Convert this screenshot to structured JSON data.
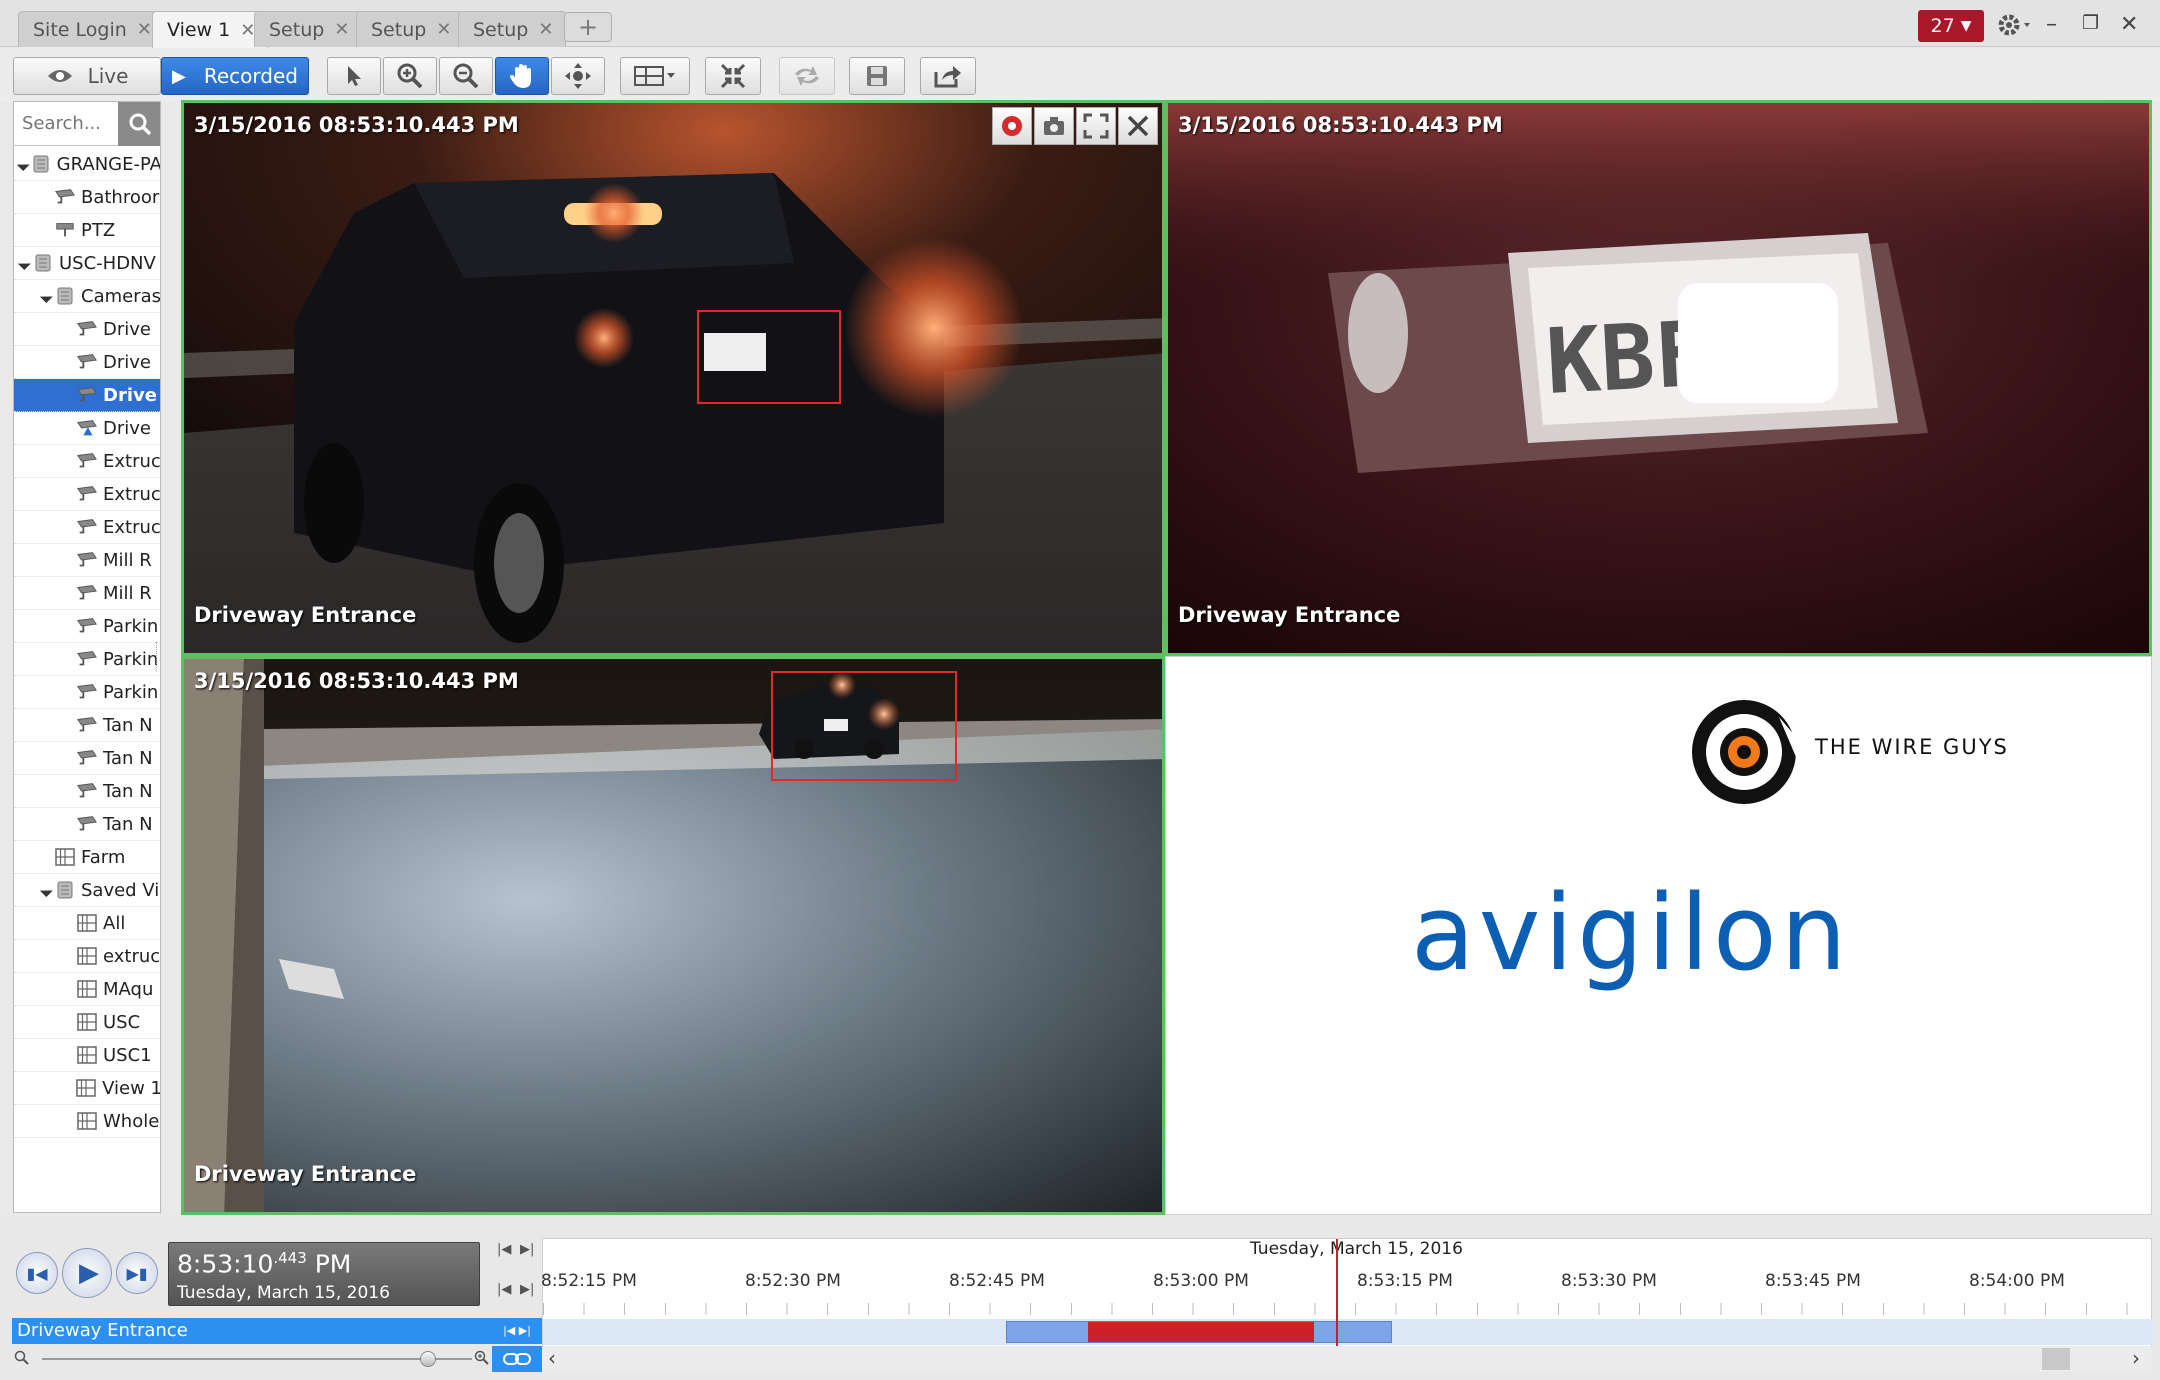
{
  "tabs": [
    {
      "label": "Site Login",
      "active": false
    },
    {
      "label": "View 1",
      "active": true
    },
    {
      "label": "Setup",
      "active": false
    },
    {
      "label": "Setup",
      "active": false
    },
    {
      "label": "Setup",
      "active": false
    }
  ],
  "tab_add": "+",
  "alarm_count": "27",
  "toolbar": {
    "live_label": "Live",
    "recorded_label": "Recorded"
  },
  "search": {
    "placeholder": "Search..."
  },
  "tree": [
    {
      "label": "GRANGE-PA",
      "level": 0,
      "icon": "server-icon",
      "expanded": true
    },
    {
      "label": "Bathroor",
      "level": 1,
      "icon": "camera-icon"
    },
    {
      "label": "PTZ",
      "level": 1,
      "icon": "ptz-camera-icon"
    },
    {
      "label": "USC-HDNV",
      "level": 0,
      "icon": "server-icon",
      "expanded": true
    },
    {
      "label": "Cameras",
      "level": 1,
      "icon": "folder-icon",
      "expanded": true
    },
    {
      "label": "Drive",
      "level": 2,
      "icon": "camera-icon"
    },
    {
      "label": "Drive",
      "level": 2,
      "icon": "camera-icon"
    },
    {
      "label": "Drive",
      "level": 2,
      "icon": "camera-icon",
      "selected": true
    },
    {
      "label": "Drive",
      "level": 2,
      "icon": "camera-warning-icon"
    },
    {
      "label": "Extruc",
      "level": 2,
      "icon": "camera-icon"
    },
    {
      "label": "Extruc",
      "level": 2,
      "icon": "camera-icon"
    },
    {
      "label": "Extruc",
      "level": 2,
      "icon": "camera-icon"
    },
    {
      "label": "Mill R",
      "level": 2,
      "icon": "camera-icon"
    },
    {
      "label": "Mill R",
      "level": 2,
      "icon": "camera-icon"
    },
    {
      "label": "Parkin",
      "level": 2,
      "icon": "camera-icon"
    },
    {
      "label": "Parkin",
      "level": 2,
      "icon": "camera-icon"
    },
    {
      "label": "Parkin",
      "level": 2,
      "icon": "camera-icon"
    },
    {
      "label": "Tan N",
      "level": 2,
      "icon": "camera-icon"
    },
    {
      "label": "Tan N",
      "level": 2,
      "icon": "camera-icon"
    },
    {
      "label": "Tan N",
      "level": 2,
      "icon": "camera-icon"
    },
    {
      "label": "Tan N",
      "level": 2,
      "icon": "camera-icon"
    },
    {
      "label": "Farm",
      "level": 1,
      "icon": "view-icon"
    },
    {
      "label": "Saved Vi",
      "level": 1,
      "icon": "folder-icon",
      "expanded": true
    },
    {
      "label": "All",
      "level": 2,
      "icon": "view-icon"
    },
    {
      "label": "extruc",
      "level": 2,
      "icon": "view-icon"
    },
    {
      "label": "MAqu",
      "level": 2,
      "icon": "view-icon"
    },
    {
      "label": "USC",
      "level": 2,
      "icon": "view-icon"
    },
    {
      "label": "USC1",
      "level": 2,
      "icon": "view-icon"
    },
    {
      "label": "View 1",
      "level": 2,
      "icon": "view-icon"
    },
    {
      "label": "Whole",
      "level": 2,
      "icon": "view-icon"
    }
  ],
  "panes": [
    {
      "timestamp": "3/15/2016 08:53:10.443 PM",
      "camera": "Driveway Entrance"
    },
    {
      "timestamp": "3/15/2016 08:53:10.443 PM",
      "camera": "Driveway Entrance"
    },
    {
      "timestamp": "3/15/2016 08:53:10.443 PM",
      "camera": "Driveway Entrance"
    }
  ],
  "logo": {
    "company": "THE WIRE GUYS",
    "brand": "avigilon"
  },
  "playback": {
    "time_main": "8:53:10",
    "time_ms": ".443",
    "time_ampm": "PM",
    "date": "Tuesday, March 15, 2016"
  },
  "timeline": {
    "date": "Tuesday, March 15, 2016",
    "ticks": [
      "8:52:15 PM",
      "8:52:30 PM",
      "8:52:45 PM",
      "8:53:00 PM",
      "8:53:15 PM",
      "8:53:30 PM",
      "8:53:45 PM",
      "8:54:00 PM"
    ],
    "camera_row": "Driveway Entrance"
  },
  "colors": {
    "accent": "#2e6fd2",
    "pane_border": "#5fbf5f",
    "detect_box": "#e02a2a",
    "recording": "#cc1f2a",
    "alarm": "#a8182a"
  }
}
